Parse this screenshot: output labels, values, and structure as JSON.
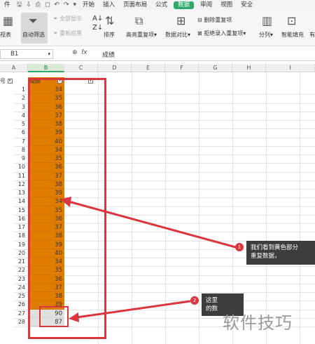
{
  "tabs": [
    "件",
    "开始",
    "插入",
    "页面布局",
    "公式",
    "数据",
    "审阅",
    "视图",
    "安全"
  ],
  "active_tab": "数据",
  "ribbon": {
    "perspective": "视表",
    "auto_filter": "自动筛选",
    "show_all": "全部显示",
    "reapply": "重新应用",
    "sort": "排序",
    "highlight_dup": "高亮重复项",
    "data_compare": "数据对比",
    "delete_dup": "删除重复项",
    "reject_dup": "拒绝录入重复项",
    "split": "分列",
    "smart_fill": "智能填充",
    "valid": "有"
  },
  "formula_bar": {
    "name_box": "B1",
    "fx": "fx",
    "content": "成绩"
  },
  "columns": [
    "A",
    "B",
    "C",
    "D",
    "E",
    "F",
    "G",
    "H",
    "I"
  ],
  "header_row": {
    "a": "号",
    "b": "成绩"
  },
  "rows": [
    {
      "num": "",
      "a": "1",
      "b": "34"
    },
    {
      "num": "",
      "a": "2",
      "b": "35"
    },
    {
      "num": "",
      "a": "3",
      "b": "36"
    },
    {
      "num": "",
      "a": "4",
      "b": "37"
    },
    {
      "num": "",
      "a": "5",
      "b": "38"
    },
    {
      "num": "",
      "a": "6",
      "b": "39"
    },
    {
      "num": "",
      "a": "7",
      "b": "40"
    },
    {
      "num": "",
      "a": "8",
      "b": "34"
    },
    {
      "num": "",
      "a": "9",
      "b": "35"
    },
    {
      "num": "",
      "a": "10",
      "b": "36"
    },
    {
      "num": "",
      "a": "11",
      "b": "37"
    },
    {
      "num": "",
      "a": "12",
      "b": "38"
    },
    {
      "num": "",
      "a": "13",
      "b": "39"
    },
    {
      "num": "",
      "a": "14",
      "b": "34"
    },
    {
      "num": "",
      "a": "15",
      "b": "35"
    },
    {
      "num": "",
      "a": "16",
      "b": "36"
    },
    {
      "num": "",
      "a": "17",
      "b": "37"
    },
    {
      "num": "",
      "a": "18",
      "b": "38"
    },
    {
      "num": "",
      "a": "19",
      "b": "39"
    },
    {
      "num": "",
      "a": "20",
      "b": "40"
    },
    {
      "num": "",
      "a": "21",
      "b": "34"
    },
    {
      "num": "",
      "a": "22",
      "b": "35"
    },
    {
      "num": "",
      "a": "23",
      "b": "36"
    },
    {
      "num": "",
      "a": "24",
      "b": "37"
    },
    {
      "num": "",
      "a": "25",
      "b": "38"
    },
    {
      "num": "",
      "a": "26",
      "b": "39"
    },
    {
      "num": "",
      "a": "27",
      "b": "90"
    },
    {
      "num": "",
      "a": "28",
      "b": "87"
    }
  ],
  "callout1": {
    "badge": "1",
    "text": "我们看到黄色部分",
    "text2": "重复数据，"
  },
  "callout2": {
    "badge": "2",
    "text": "这里",
    "text2": "的数"
  },
  "watermark": "软件技巧",
  "colors": {
    "highlight": "#e07d00",
    "accent": "#2fa86b",
    "annotation": "#d9363e"
  }
}
